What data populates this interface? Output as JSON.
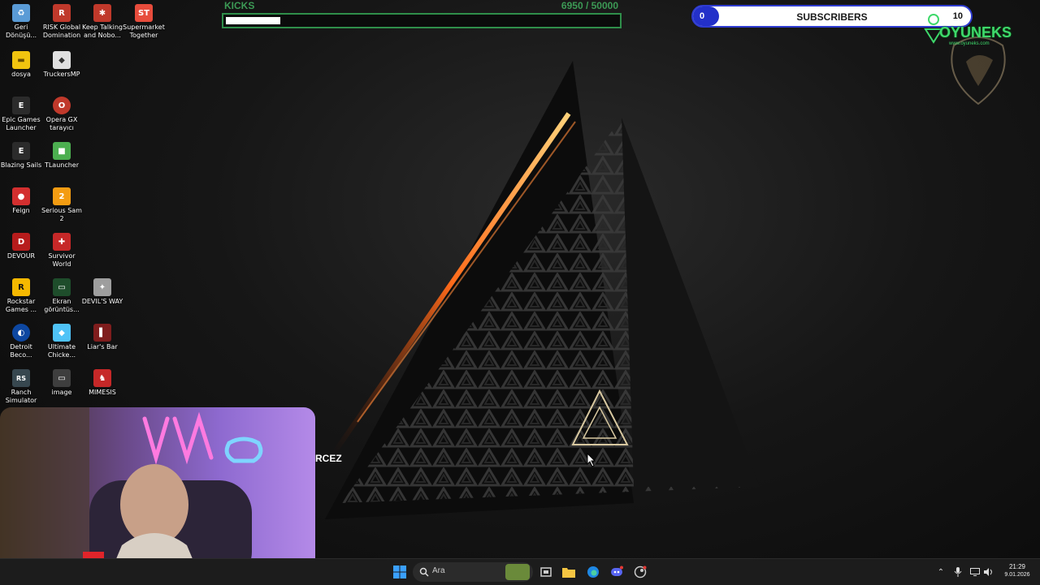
{
  "desktop": {
    "icons": [
      {
        "label": "Geri Dönüşü...",
        "color": "#5a9bd6",
        "glyph": "♻"
      },
      {
        "label": "RISK Global Domination",
        "color": "#c0392b",
        "glyph": "R"
      },
      {
        "label": "Keep Talking and Nobo...",
        "color": "#c0392b",
        "glyph": "✱"
      },
      {
        "label": "Supermarket Together",
        "color": "#e74c3c",
        "glyph": "ST"
      },
      {
        "label": "dosya",
        "color": "#f1c40f",
        "glyph": "▬"
      },
      {
        "label": "TruckersMP",
        "color": "#e0e0e0",
        "glyph": "◆"
      },
      {
        "label": "Epic Games Launcher",
        "color": "#2b2b2b",
        "glyph": "E"
      },
      {
        "label": "Opera GX tarayıcı",
        "color": "#c0392b",
        "glyph": "O"
      },
      {
        "label": "Blazing Sails",
        "color": "#2b2b2b",
        "glyph": "E"
      },
      {
        "label": "TLauncher",
        "color": "#4caf50",
        "glyph": "■"
      },
      {
        "label": "Feign",
        "color": "#d32f2f",
        "glyph": "●"
      },
      {
        "label": "Serious Sam 2",
        "color": "#f39c12",
        "glyph": "2"
      },
      {
        "label": "DEVOUR",
        "color": "#b71c1c",
        "glyph": "D"
      },
      {
        "label": "Survivor World",
        "color": "#c62828",
        "glyph": "✚"
      },
      {
        "label": "Rockstar Games ...",
        "color": "#f5b800",
        "glyph": "R"
      },
      {
        "label": "Ekran görüntüs...",
        "color": "#1e4d2b",
        "glyph": "▭"
      },
      {
        "label": "DEVIL'S WAY",
        "color": "#9e9e9e",
        "glyph": "✦"
      },
      {
        "label": "Detroit Beco...",
        "color": "#0d47a1",
        "glyph": "◐"
      },
      {
        "label": "Ultimate Chicke...",
        "color": "#4fc3f7",
        "glyph": "◆"
      },
      {
        "label": "Liar's Bar",
        "color": "#7f1d1d",
        "glyph": "▌"
      },
      {
        "label": "Ranch Simulator",
        "color": "#37474f",
        "glyph": "RS"
      },
      {
        "label": "image",
        "color": "#3e3e3e",
        "glyph": "▭"
      },
      {
        "label": "MIMESIS",
        "color": "#c62828",
        "glyph": "♞"
      }
    ]
  },
  "overlay": {
    "kicks": {
      "label": "KICKS",
      "count": "6950 / 50000",
      "progress": 0.139,
      "color": "#2f8e4a"
    },
    "subscribers": {
      "current": "0",
      "label": "SUBSCRIBERS",
      "goal": "10",
      "accent": "#2330c9"
    },
    "brand": {
      "name": "OYUNEKS",
      "url": "www.oyuneks.com"
    },
    "webcam_caption": "RCEZ"
  },
  "taskbar": {
    "start_icon": "windows-icon",
    "search_placeholder": "Ara",
    "apps": [
      "game-thumbnail-icon",
      "task-view-icon",
      "file-explorer-icon",
      "edge-icon",
      "discord-icon",
      "steam-icon"
    ],
    "tray": [
      "chevron-up-icon",
      "microphone-icon",
      "display-icon",
      "volume-icon"
    ],
    "clock": {
      "time": "21:29",
      "date": "9.01.2026"
    }
  }
}
